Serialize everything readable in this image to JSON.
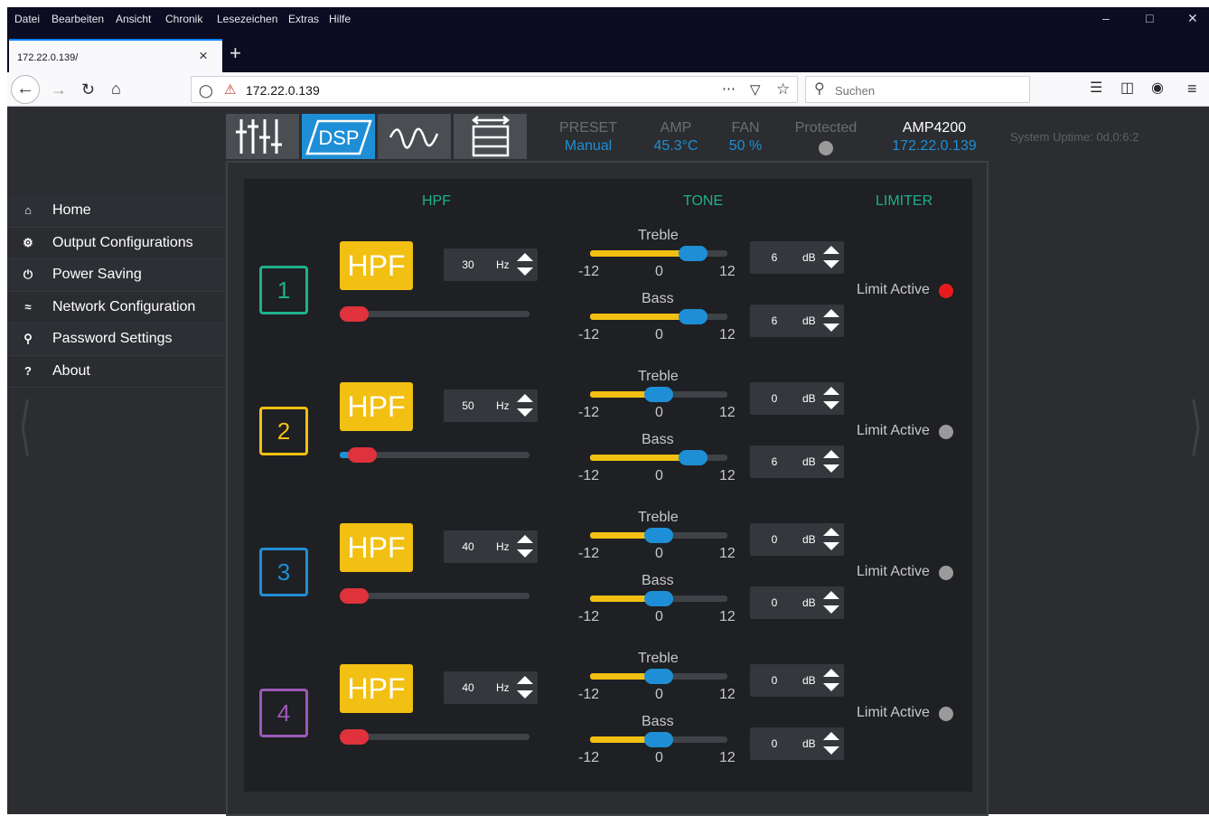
{
  "browser": {
    "menu": [
      "Datei",
      "Bearbeiten",
      "Ansicht",
      "Chronik",
      "Lesezeichen",
      "Extras",
      "Hilfe"
    ],
    "tab_title": "172.22.0.139/",
    "url": "172.22.0.139",
    "search_placeholder": "Suchen"
  },
  "sidebar": {
    "items": [
      {
        "label": "Home",
        "icon": "home-icon"
      },
      {
        "label": "Output Configurations",
        "icon": "gear-icon"
      },
      {
        "label": "Power Saving",
        "icon": "power-icon"
      },
      {
        "label": "Network Configuration",
        "icon": "wifi-icon"
      },
      {
        "label": "Password Settings",
        "icon": "key-icon"
      },
      {
        "label": "About",
        "icon": "question-icon"
      }
    ]
  },
  "toolbar": {
    "dsp_label": "DSP"
  },
  "status": {
    "preset_label": "PRESET",
    "preset_value": "Manual",
    "amp_label": "AMP",
    "amp_value": "45.3°C",
    "fan_label": "FAN",
    "fan_value": "50 %",
    "protected_label": "Protected",
    "device_name": "AMP4200",
    "device_ip": "172.22.0.139",
    "uptime": "System Uptime: 0d,0:6:2"
  },
  "headers": {
    "hpf": "HPF",
    "tone": "TONE",
    "limiter": "LIMITER"
  },
  "colors": {
    "accent": "#1e8fd6",
    "header_green": "#1db18a",
    "hpf_yellow": "#f2c012",
    "knob_red": "#e0323c",
    "limit_active": "#e81b1b",
    "limit_idle": "#9a9a9a"
  },
  "labels": {
    "hpf_button": "HPF",
    "hz": "Hz",
    "db": "dB",
    "treble": "Treble",
    "bass": "Bass",
    "tick_min": "-12",
    "tick_mid": "0",
    "tick_max": "12",
    "limit_active": "Limit Active"
  },
  "channels": [
    {
      "number": "1",
      "color": "#1db18a",
      "hpf_hz": "30",
      "hpf_level": 0.02,
      "treble_db": "6",
      "bass_db": "6",
      "treble_level": 0.75,
      "bass_level": 0.75,
      "limit_on": true
    },
    {
      "number": "2",
      "color": "#f2c012",
      "hpf_hz": "50",
      "hpf_level": 0.12,
      "treble_db": "0",
      "bass_db": "6",
      "treble_level": 0.5,
      "bass_level": 0.75,
      "limit_on": false
    },
    {
      "number": "3",
      "color": "#1e8fd6",
      "hpf_hz": "40",
      "hpf_level": 0.07,
      "treble_db": "0",
      "bass_db": "0",
      "treble_level": 0.5,
      "bass_level": 0.5,
      "limit_on": false
    },
    {
      "number": "4",
      "color": "#9b59b6",
      "hpf_hz": "40",
      "hpf_level": 0.07,
      "treble_db": "0",
      "bass_db": "0",
      "treble_level": 0.5,
      "bass_level": 0.5,
      "limit_on": false
    }
  ]
}
